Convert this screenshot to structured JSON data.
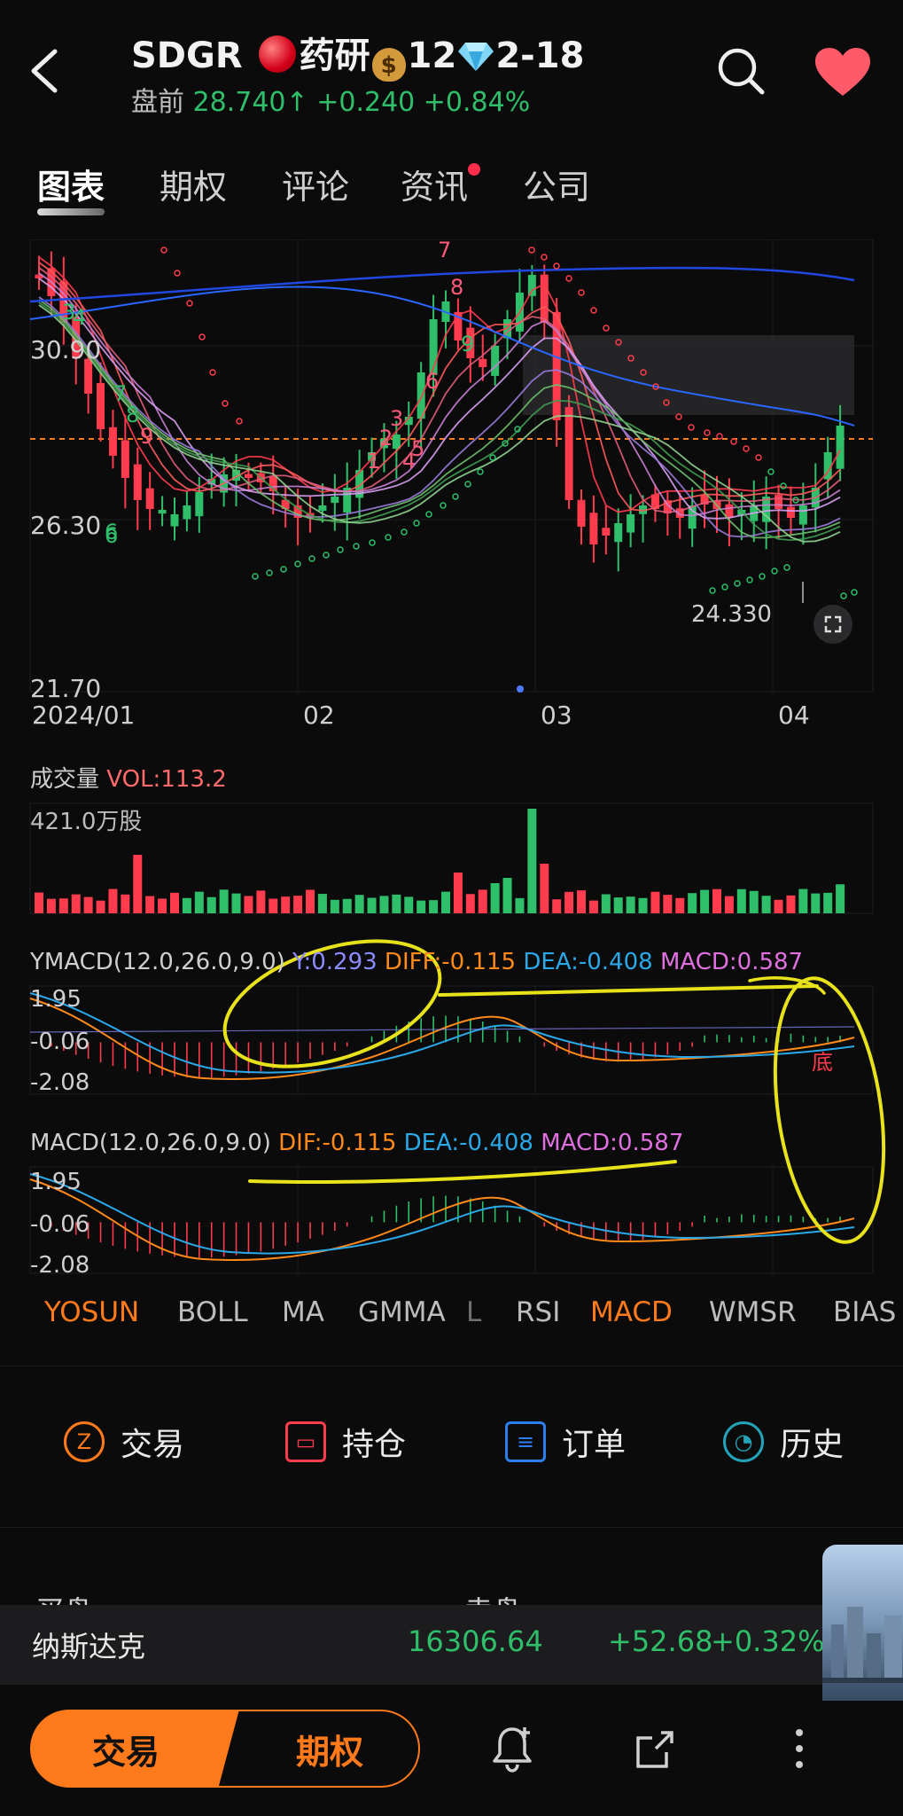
{
  "header": {
    "back_label": "‹",
    "ticker": "SDGR",
    "name_part1": "药研",
    "num": "12",
    "suffix": "2-18",
    "premarket_label": "盘前",
    "price": "28.740",
    "change": "+0.240",
    "change_pct": "+0.84%",
    "price_color": "#2fbf6b"
  },
  "tabs": [
    {
      "label": "图表",
      "active": true
    },
    {
      "label": "期权"
    },
    {
      "label": "评论"
    },
    {
      "label": "资讯"
    },
    {
      "label": "公司"
    }
  ],
  "main_chart": {
    "y_labels": [
      "30.90",
      "26.30",
      "21.70"
    ],
    "x_labels": [
      "2024/01",
      "02",
      "03",
      "04"
    ],
    "low_marker": "24.330",
    "wave_labels": [
      "7",
      "8",
      "9",
      "6",
      "3",
      "2",
      "1",
      "4",
      "5",
      "3",
      "4",
      "6",
      "7",
      "8",
      "9",
      "6"
    ]
  },
  "volume": {
    "title": "成交量",
    "vol_label": "VOL:113.2",
    "max_label": "421.0万股"
  },
  "ymacd": {
    "title": "YMACD(12.0,26.0,9.0)",
    "y": "Y:0.293",
    "diff": "DIFF:-0.115",
    "dea": "DEA:-0.408",
    "macd": "MACD:0.587",
    "y_labels": [
      "1.95",
      "-0.06",
      "-2.08"
    ],
    "bottom_mark": "底"
  },
  "macd": {
    "title": "MACD(12.0,26.0,9.0)",
    "dif": "DIF:-0.115",
    "dea": "DEA:-0.408",
    "macd": "MACD:0.587",
    "y_labels": [
      "1.95",
      "-0.06",
      "-2.08"
    ]
  },
  "indicators": [
    "YOSUN",
    "BOLL",
    "MA",
    "GMMA",
    "L",
    "RSI",
    "MACD",
    "WMSR",
    "BIAS"
  ],
  "actions": [
    {
      "label": "交易",
      "icon": "trade-icon"
    },
    {
      "label": "持仓",
      "icon": "position-icon"
    },
    {
      "label": "订单",
      "icon": "order-icon"
    },
    {
      "label": "历史",
      "icon": "history-icon"
    }
  ],
  "ticker_bar": {
    "name": "纳斯达克",
    "value": "16306.64",
    "change": "+52.68",
    "change_pct": "+0.32%",
    "partial_hidden_left": "买盘",
    "partial_hidden_right": "卖盘"
  },
  "bottom": {
    "trade_button": "交易",
    "options_button": "期权"
  },
  "colors": {
    "accent": "#ff7a1a",
    "up": "#ff3b4e",
    "down": "#2fbf6b",
    "dea": "#1f9fe0",
    "macd": "#e070e0"
  }
}
